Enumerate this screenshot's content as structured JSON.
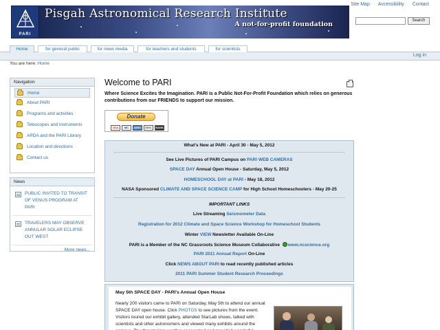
{
  "header": {
    "logo_text": "PARI",
    "site_title": "Pisgah Astronomical Research Institute",
    "tagline": "A not-for-profit foundation"
  },
  "top_links": [
    "Site Map",
    "Accessibility",
    "Contact"
  ],
  "search": {
    "placeholder": "",
    "button": "Search"
  },
  "tabs": [
    "Home",
    "for general public",
    "for news media",
    "for teachers and students",
    "for scientists"
  ],
  "login": "Log in",
  "breadcrumb": {
    "label": "You are here:",
    "home": "Home"
  },
  "navigation": {
    "title": "Navigation",
    "items": [
      "Home",
      "About PARI",
      "Programs and activities",
      "Telescopes and instruments",
      "APDA and the PARI Library",
      "Location and directions",
      "Contact us"
    ]
  },
  "news": {
    "title": "News",
    "items": [
      "Public invited to transit of Venus program at PARI",
      "Travelers may observe annular solar eclipse out west"
    ],
    "more": "More news..."
  },
  "main": {
    "title": "Welcome to PARI",
    "intro": "Where Science Excites the Imagination. PARI is a Public Not-For-Profit Foundation which relies on generous contributions from our FRIENDS to support our mission.",
    "donate": "Donate",
    "cards": [
      "VISA",
      "MC",
      "AMEX",
      "DISC",
      "BANK"
    ]
  },
  "whats_new": {
    "heading": "What's New at PARI - April 30 - May 5, 2012",
    "l1_pre": "See Live Pictures of PARI Campus on ",
    "l1_link": "PARI WEB CAMERAS",
    "l2_link": "SPACE DAY",
    "l2_post": " Annual Open House - Saturday, May 5, 2012",
    "l3_link": "HOMESCHOOL DAY at PARI",
    "l3_post": " - May 18, 2012",
    "l4_pre": "NASA Sponsored ",
    "l4_link": "CLIMATE AND SPACE SCIENCE CAMP",
    "l4_post": " for High School Homeschoolers - May 20-25",
    "important": "IMPORTANT LINKS",
    "l5_pre": "Live Streaming ",
    "l5_link": "Seismometer Data",
    "l6_link": "Registration for 2012 Climate and Space Science Workshop for Homeschool Students",
    "l7_pre": "Winter ",
    "l7_link": "VIEW",
    "l7_post": " Newsletter Available On-Line",
    "l8_pre": "PARI is a Member of the NC Grassroots Science Museum Collaborative ",
    "l8_link": "www.ncscience.org",
    "l9_link": "PARI 2011 Annual Report",
    "l9_post": " On-Line",
    "l10_pre": "Click ",
    "l10_link": "NEWS ABOUT PARI",
    "l10_post": " to read recently published articles",
    "l11_link": "2011 PARI Summer Student Research Proceedings"
  },
  "article": {
    "heading": "May 5th SPACE DAY - PARI's Annual Open House",
    "body_pre": "Nearly 200 visitors came to PARI on Saturday, May 5th to attend our annual SPACE DAY open house. Click ",
    "body_link": "PHOTOS",
    "body_post": " to see pictures from the event. Visitors toured our exhibit gallery, attended StarLab shows, talked with scientists and other astronomers and viewed many exhibits around the campus. The threatening weather cooperated and provided wonderful"
  }
}
